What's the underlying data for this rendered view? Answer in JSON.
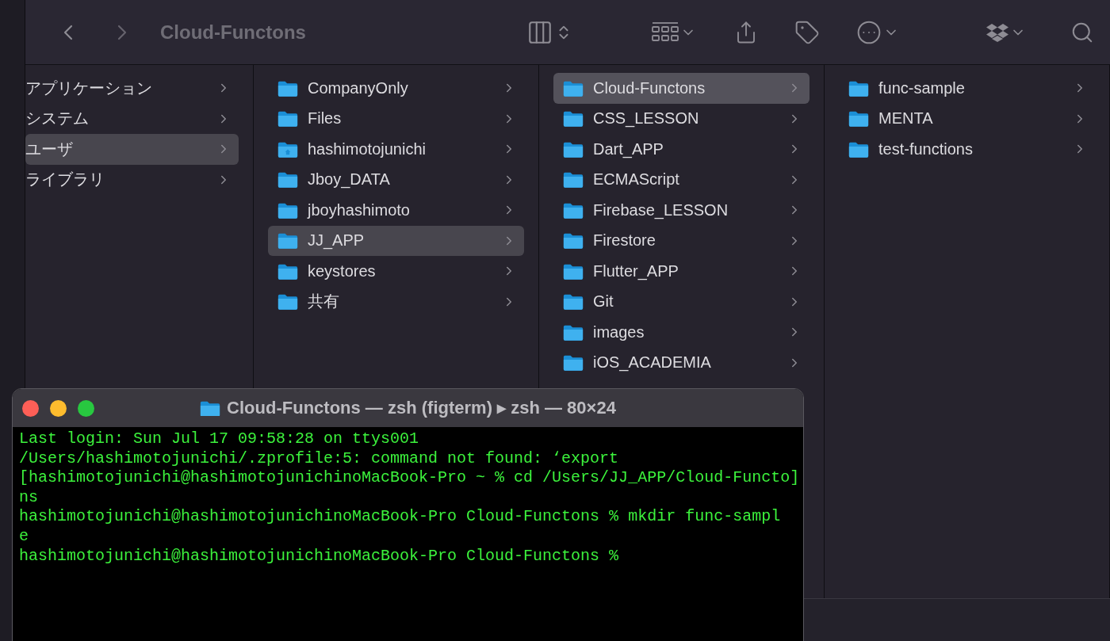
{
  "finder": {
    "title": "Cloud-Functons",
    "columns": [
      {
        "items": [
          {
            "name": "アプリケーション",
            "kind": "folder-less",
            "selected": false
          },
          {
            "name": "システム",
            "kind": "folder-less",
            "selected": false
          },
          {
            "name": "ユーザ",
            "kind": "folder-less",
            "selected": true
          },
          {
            "name": "ライブラリ",
            "kind": "folder-less",
            "selected": false
          }
        ]
      },
      {
        "items": [
          {
            "name": "CompanyOnly",
            "kind": "folder",
            "selected": false
          },
          {
            "name": "Files",
            "kind": "folder",
            "selected": false
          },
          {
            "name": "hashimotojunichi",
            "kind": "home",
            "selected": false
          },
          {
            "name": "Jboy_DATA",
            "kind": "folder",
            "selected": false
          },
          {
            "name": "jboyhashimoto",
            "kind": "folder",
            "selected": false
          },
          {
            "name": "JJ_APP",
            "kind": "folder",
            "selected": true
          },
          {
            "name": "keystores",
            "kind": "folder",
            "selected": false
          },
          {
            "name": "共有",
            "kind": "folder",
            "selected": false
          }
        ]
      },
      {
        "items": [
          {
            "name": "Cloud-Functons",
            "kind": "folder",
            "selected": true
          },
          {
            "name": "CSS_LESSON",
            "kind": "folder",
            "selected": false
          },
          {
            "name": "Dart_APP",
            "kind": "folder",
            "selected": false
          },
          {
            "name": "ECMAScript",
            "kind": "folder",
            "selected": false
          },
          {
            "name": "Firebase_LESSON",
            "kind": "folder",
            "selected": false
          },
          {
            "name": "Firestore",
            "kind": "folder",
            "selected": false
          },
          {
            "name": "Flutter_APP",
            "kind": "folder",
            "selected": false
          },
          {
            "name": "Git",
            "kind": "folder",
            "selected": false
          },
          {
            "name": "images",
            "kind": "folder",
            "selected": false
          },
          {
            "name": "iOS_ACADEMIA",
            "kind": "folder",
            "selected": false
          }
        ]
      },
      {
        "items": [
          {
            "name": "func-sample",
            "kind": "folder",
            "selected": false
          },
          {
            "name": "MENTA",
            "kind": "folder",
            "selected": false
          },
          {
            "name": "test-functions",
            "kind": "folder",
            "selected": false
          }
        ]
      }
    ]
  },
  "terminal": {
    "title": "Cloud-Functons — zsh (figterm) ▸ zsh — 80×24",
    "lines": [
      "Last login: Sun Jul 17 09:58:28 on ttys001",
      "/Users/hashimotojunichi/.zprofile:5: command not found: ‘export",
      "[hashimotojunichi@hashimotojunichinoMacBook-Pro ~ % cd /Users/JJ_APP/Cloud-Functo]",
      "ns",
      "hashimotojunichi@hashimotojunichinoMacBook-Pro Cloud-Functons % mkdir func-sampl",
      "e",
      "hashimotojunichi@hashimotojunichinoMacBook-Pro Cloud-Functons %"
    ]
  }
}
